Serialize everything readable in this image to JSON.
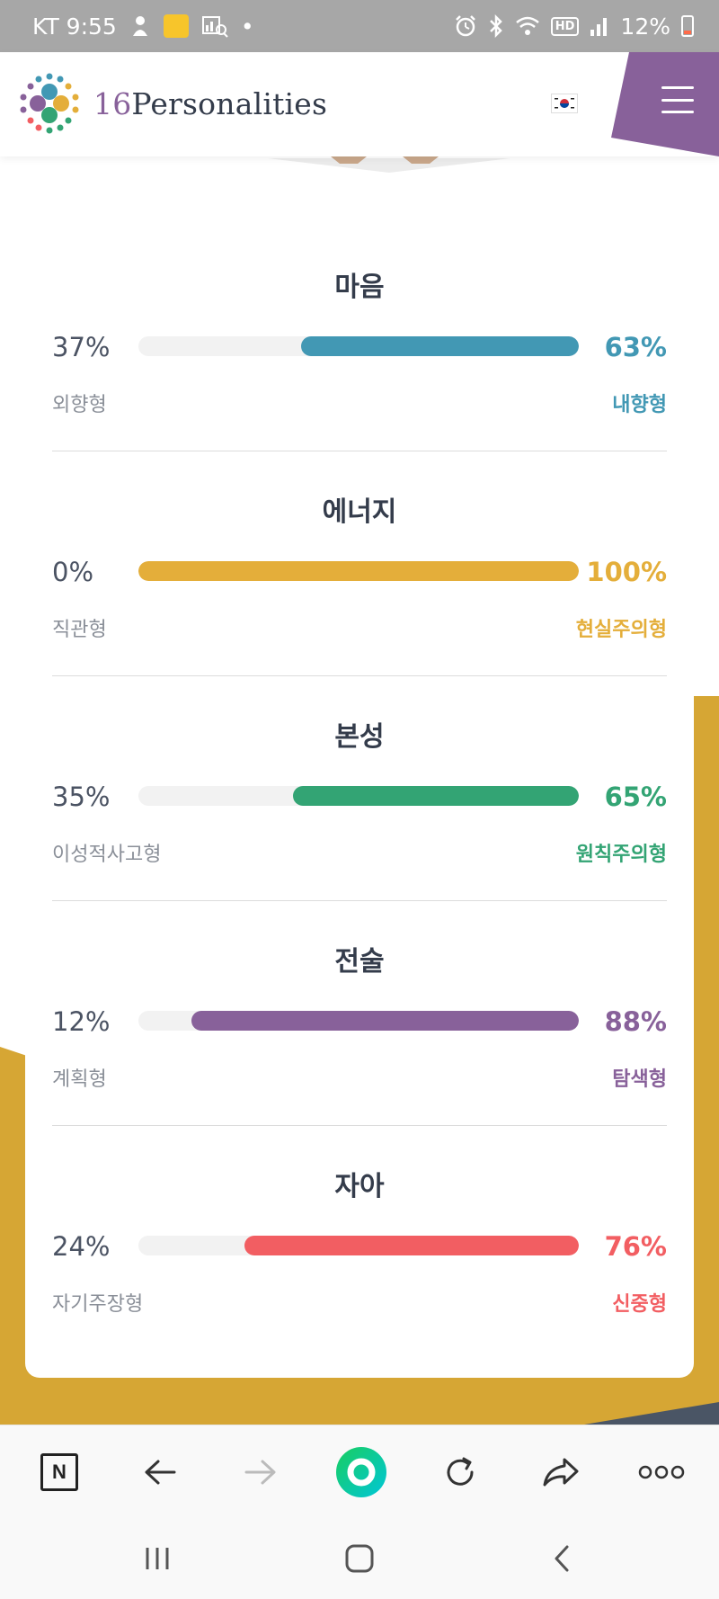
{
  "status_bar": {
    "carrier_time": "KT 9:55",
    "dot": "•",
    "battery": "12%",
    "hd": "HD"
  },
  "header": {
    "logo_number": "16",
    "logo_word": "Personalities",
    "menu_icon": "hamburger-menu-icon",
    "flag_icon": "korea-flag-icon",
    "accent_color": "#88619a"
  },
  "traits": [
    {
      "title": "마음",
      "left_pct": "37%",
      "right_pct": "63%",
      "left_label": "외향형",
      "right_label": "내향형",
      "value": 63,
      "color": "#4298b4"
    },
    {
      "title": "에너지",
      "left_pct": "0%",
      "right_pct": "100%",
      "left_label": "직관형",
      "right_label": "현실주의형",
      "value": 100,
      "color": "#e4ae3a"
    },
    {
      "title": "본성",
      "left_pct": "35%",
      "right_pct": "65%",
      "left_label": "이성적사고형",
      "right_label": "원칙주의형",
      "value": 65,
      "color": "#33a474"
    },
    {
      "title": "전술",
      "left_pct": "12%",
      "right_pct": "88%",
      "left_label": "계획형",
      "right_label": "탐색형",
      "value": 88,
      "color": "#88619a"
    },
    {
      "title": "자아",
      "left_pct": "24%",
      "right_pct": "76%",
      "left_label": "자기주장형",
      "right_label": "신중형",
      "value": 76,
      "color": "#f25e62"
    }
  ],
  "browser_toolbar": {
    "n_label": "N",
    "icons": [
      "naver-icon",
      "back-arrow-icon",
      "forward-arrow-icon",
      "green-window-icon",
      "reload-icon",
      "share-icon",
      "more-icon"
    ]
  },
  "nav_bar": {
    "icons": [
      "recent-apps-icon",
      "home-icon",
      "back-icon"
    ]
  },
  "colors": {
    "gold": "#d6a634",
    "purple": "#88619a",
    "dark": "#343c4b"
  }
}
